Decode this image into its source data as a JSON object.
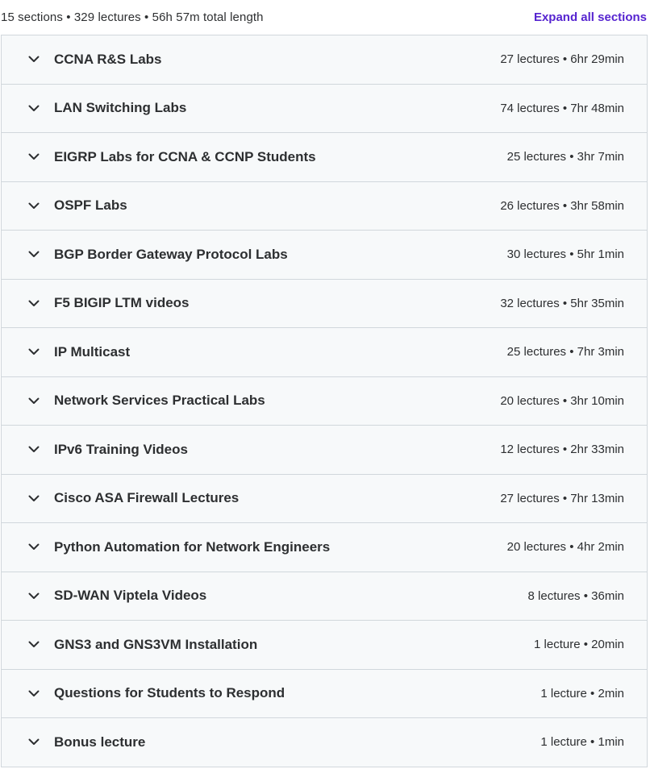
{
  "summary": {
    "text": "15 sections • 329 lectures • 56h 57m total length",
    "expand_label": "Expand all sections"
  },
  "colors": {
    "link": "#5624d0",
    "row_bg": "#f7f9fa",
    "border": "#d1d7dc",
    "text": "#2d2f31"
  },
  "sections": [
    {
      "title": "CCNA R&S Labs",
      "meta": "27 lectures • 6hr 29min"
    },
    {
      "title": "LAN Switching Labs",
      "meta": "74 lectures • 7hr 48min"
    },
    {
      "title": "EIGRP Labs for CCNA & CCNP Students",
      "meta": "25 lectures • 3hr 7min"
    },
    {
      "title": "OSPF Labs",
      "meta": "26 lectures • 3hr 58min"
    },
    {
      "title": "BGP Border Gateway Protocol Labs",
      "meta": "30 lectures • 5hr 1min"
    },
    {
      "title": "F5 BIGIP LTM videos",
      "meta": "32 lectures • 5hr 35min"
    },
    {
      "title": "IP Multicast",
      "meta": "25 lectures • 7hr 3min"
    },
    {
      "title": "Network Services Practical Labs",
      "meta": "20 lectures • 3hr 10min"
    },
    {
      "title": "IPv6 Training Videos",
      "meta": "12 lectures • 2hr 33min"
    },
    {
      "title": "Cisco ASA Firewall Lectures",
      "meta": "27 lectures • 7hr 13min"
    },
    {
      "title": "Python Automation for Network Engineers",
      "meta": "20 lectures • 4hr 2min"
    },
    {
      "title": "SD-WAN Viptela Videos",
      "meta": "8 lectures • 36min"
    },
    {
      "title": "GNS3 and GNS3VM Installation",
      "meta": "1 lecture • 20min"
    },
    {
      "title": "Questions for Students to Respond",
      "meta": "1 lecture • 2min"
    },
    {
      "title": "Bonus lecture",
      "meta": "1 lecture • 1min"
    }
  ],
  "icons": {
    "section_toggle": "chevron-down-icon"
  }
}
